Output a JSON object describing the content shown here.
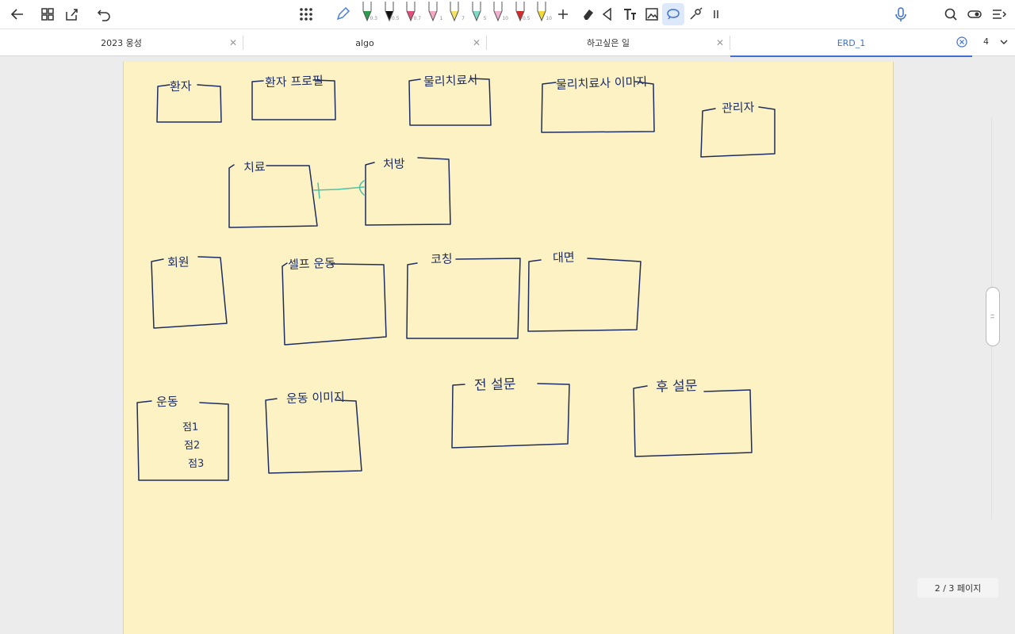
{
  "tabs": [
    {
      "label": "2023 웅성"
    },
    {
      "label": "algo"
    },
    {
      "label": "하고싶은 일"
    },
    {
      "label": "ERD_1"
    }
  ],
  "tab_count": "4",
  "page_indicator": "2 / 3 페이지",
  "pen_sizes": [
    "0.3",
    "0.5",
    "0.7",
    "1",
    "7",
    "5",
    "10",
    "0.5",
    "10"
  ],
  "pen_colors": [
    "#2e9d4e",
    "#111111",
    "#e0507a",
    "#f2a8c2",
    "#f5e06a",
    "#7fd9c7",
    "#f0b0d0",
    "#d42a2a",
    "#f3d93a"
  ],
  "entities": [
    "환자",
    "환자 프로필",
    "물리치료사",
    "물리치료사 이미지",
    "관리자",
    "치료",
    "처방",
    "회원",
    "셀프 운동",
    "코칭",
    "대면",
    "운동",
    "운동 이미지",
    "전 설문",
    "후 설문"
  ],
  "exercise_attrs": [
    "점1",
    "점2",
    "점3"
  ],
  "colors": {
    "accent": "#3f6fd1",
    "page": "#fdf2c4",
    "ink": "#1d2d63",
    "relation": "#4cc3a4"
  }
}
